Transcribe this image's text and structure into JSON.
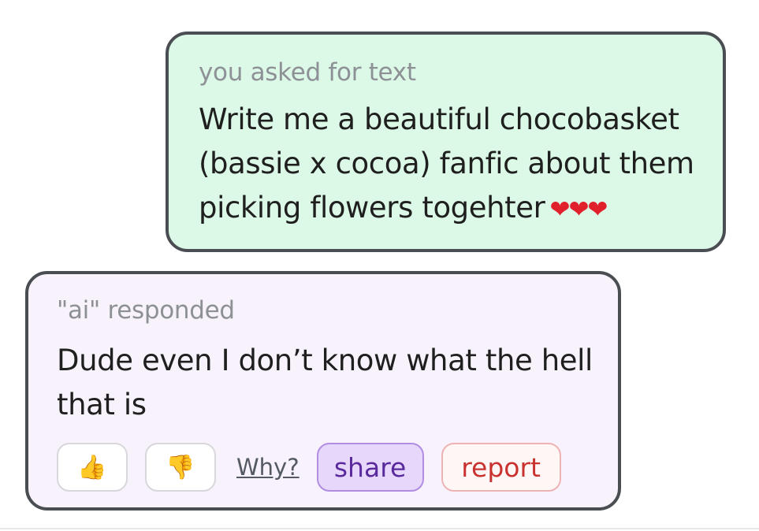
{
  "user_message": {
    "meta_label": "you asked for text",
    "text": "Write me a beautiful chocobasket (bassie x cocoa) fanfic about them picking flowers togehter",
    "hearts": "❤❤❤"
  },
  "ai_message": {
    "meta_label": "\"ai\" responded",
    "text": "Dude even I don’t know what the hell that is"
  },
  "actions": {
    "thumbs_up_icon": "👍",
    "thumbs_down_icon": "👎",
    "why_label": "Why?",
    "share_label": "share",
    "report_label": "report"
  },
  "colors": {
    "user_bubble_bg": "#dcf8e6",
    "ai_bubble_bg": "#f7f2fb",
    "share_accent": "#5a2a9c",
    "report_accent": "#c9332f",
    "heart": "#e0202a"
  }
}
